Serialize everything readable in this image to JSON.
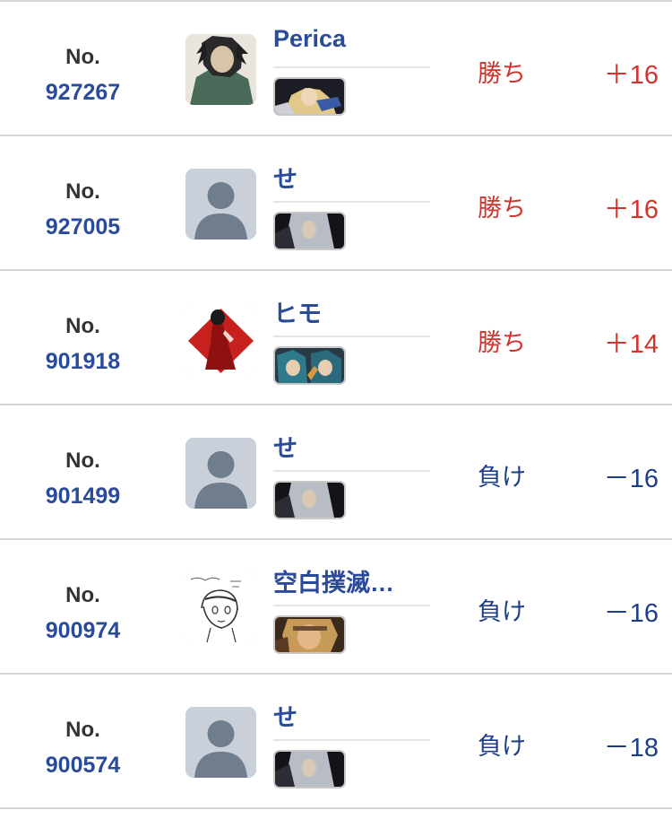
{
  "no_label": "No.",
  "colors": {
    "number": "#2a4a9a",
    "win": "#d0342c",
    "lose": "#1e3e88",
    "divider": "#d6d6d6"
  },
  "matches": [
    {
      "number": "927267",
      "name": "Perica",
      "avatar": "character-portrait-avatar",
      "fighter": "blonde-fighter-icon",
      "result": "勝ち",
      "points": "＋16",
      "outcome": "win"
    },
    {
      "number": "927005",
      "name": "せ",
      "avatar": "default-avatar-icon",
      "fighter": "silver-hair-fighter-icon",
      "result": "勝ち",
      "points": "＋16",
      "outcome": "win"
    },
    {
      "number": "901918",
      "name": "ヒモ",
      "avatar": "red-dress-avatar",
      "fighter": "teal-hair-twin-fighter-icon",
      "result": "勝ち",
      "points": "＋14",
      "outcome": "win"
    },
    {
      "number": "901499",
      "name": "せ",
      "avatar": "default-avatar-icon",
      "fighter": "silver-hair-fighter-icon",
      "result": "負け",
      "points": "－16",
      "outcome": "lose"
    },
    {
      "number": "900974",
      "name": "空白撲滅…",
      "avatar": "sketch-drawing-avatar",
      "fighter": "headband-fighter-icon",
      "result": "負け",
      "points": "－16",
      "outcome": "lose"
    },
    {
      "number": "900574",
      "name": "せ",
      "avatar": "default-avatar-icon",
      "fighter": "silver-hair-fighter-icon",
      "result": "負け",
      "points": "－18",
      "outcome": "lose"
    }
  ]
}
